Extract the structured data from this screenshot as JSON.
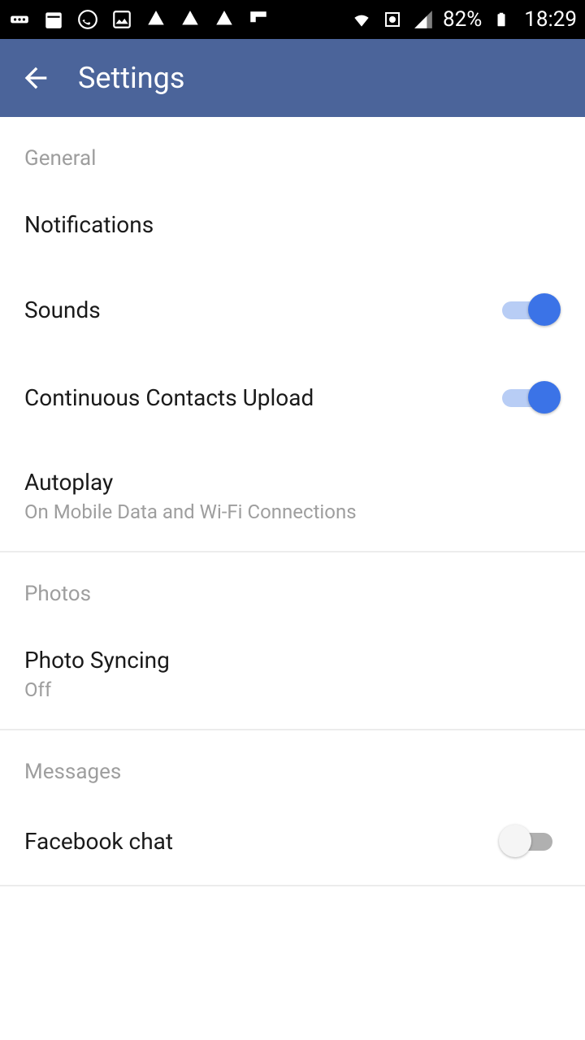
{
  "status_bar": {
    "battery_percent": "82%",
    "clock": "18:29"
  },
  "header": {
    "title": "Settings"
  },
  "sections": {
    "general": {
      "header": "General",
      "notifications": {
        "title": "Notifications"
      },
      "sounds": {
        "title": "Sounds",
        "on": true
      },
      "contacts_upload": {
        "title": "Continuous Contacts Upload",
        "on": true
      },
      "autoplay": {
        "title": "Autoplay",
        "sub": "On Mobile Data and Wi-Fi Connections"
      }
    },
    "photos": {
      "header": "Photos",
      "photo_syncing": {
        "title": "Photo Syncing",
        "sub": "Off"
      }
    },
    "messages": {
      "header": "Messages",
      "facebook_chat": {
        "title": "Facebook chat",
        "on": false
      }
    }
  }
}
